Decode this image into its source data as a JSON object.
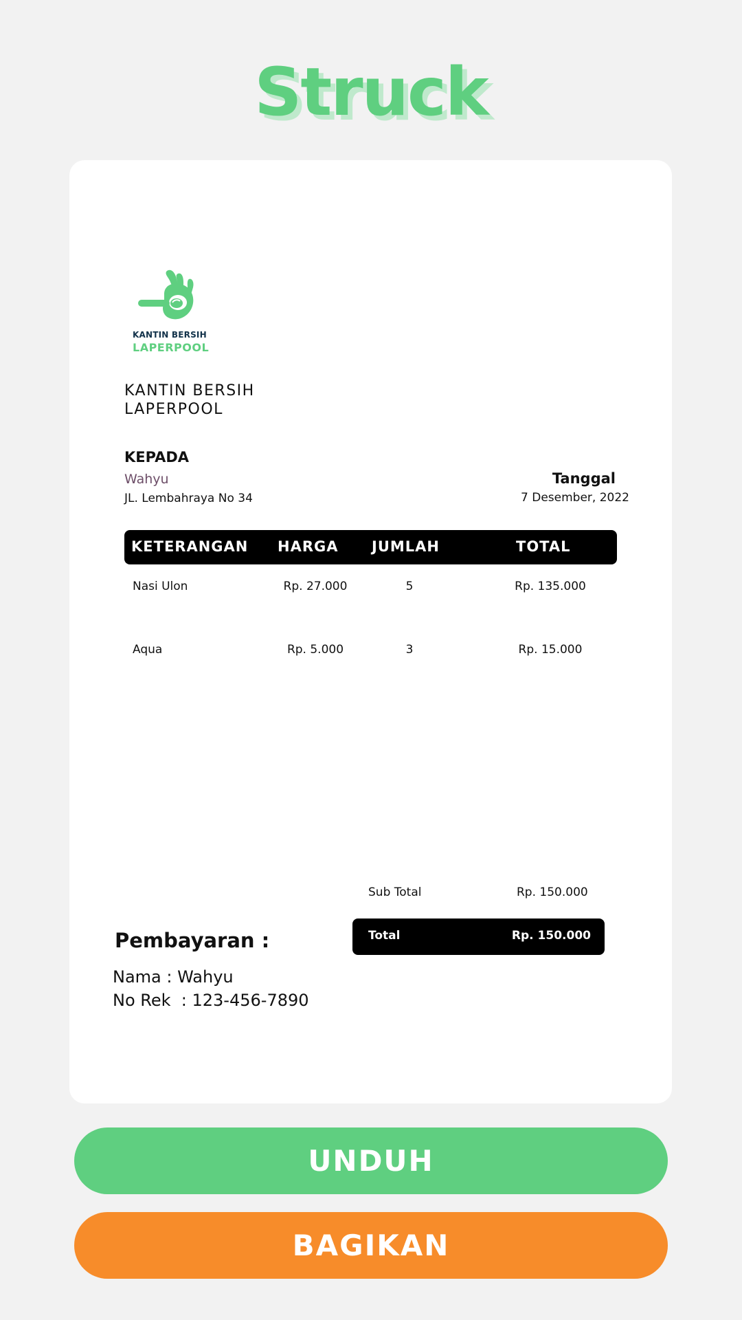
{
  "page": {
    "title": "Struck"
  },
  "receipt": {
    "logo": {
      "line1": "KANTIN BERSIH",
      "line2": "LAPERPOOL"
    },
    "shop_name_line1": "KANTIN BERSIH",
    "shop_name_line2": "LAPERPOOL",
    "to_label": "KEPADA",
    "customer_name": "Wahyu",
    "customer_address": "JL. Lembahraya No 34",
    "date_label": "Tanggal",
    "date_value": "7 Desember, 2022",
    "table": {
      "headers": [
        "KETERANGAN",
        "HARGA",
        "JUMLAH",
        "TOTAL"
      ],
      "rows": [
        {
          "desc": "Nasi Ulon",
          "price": "Rp. 27.000",
          "qty": "5",
          "total": "Rp. 135.000"
        },
        {
          "desc": "Aqua",
          "price": "Rp. 5.000",
          "qty": "3",
          "total": "Rp. 15.000"
        }
      ]
    },
    "subtotal_label": "Sub Total",
    "subtotal_value": "Rp. 150.000",
    "total_label": "Total",
    "total_value": "Rp. 150.000",
    "payment_label": "Pembayaran :",
    "payment_name": "Nama : Wahyu",
    "payment_account": "No Rek  : 123-456-7890"
  },
  "actions": {
    "download_label": "UNDUH",
    "share_label": "BAGIKAN"
  },
  "colors": {
    "brand_green": "#5fcf80",
    "share_orange": "#f78c2a",
    "logo_navy": "#12324a"
  },
  "icons": {
    "logo": "hand-ok-spoon-logo-icon"
  }
}
